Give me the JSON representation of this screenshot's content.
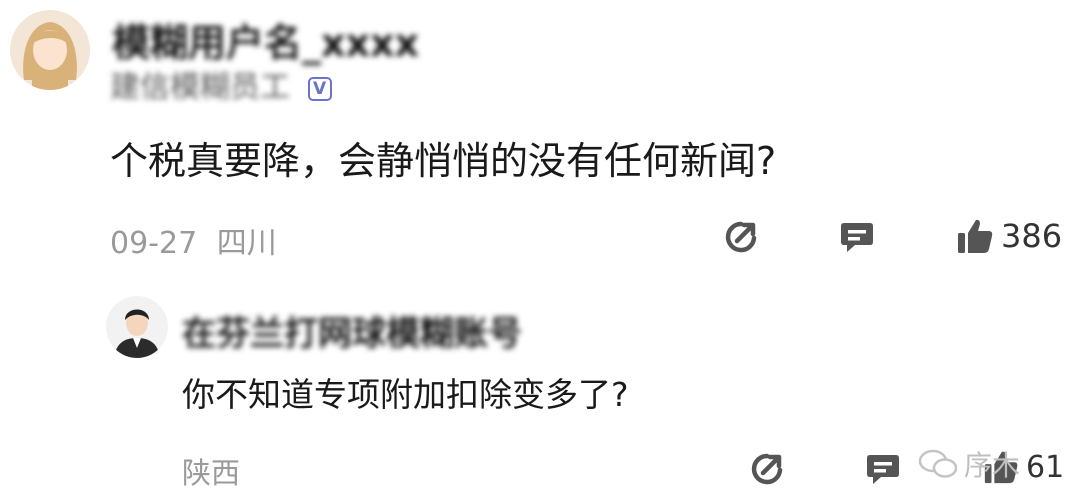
{
  "comment": {
    "username": "模糊用户名_xxxx",
    "user_subtitle": "建信模糊员工",
    "verified_mark": "V",
    "text": "个税真要降，会静悄悄的没有任何新闻?",
    "date": "09-27",
    "location": "四川",
    "like_count": "386"
  },
  "reply": {
    "username": "在芬兰打网球模糊账号",
    "text": "你不知道专项附加扣除变多了?",
    "location": "陕西",
    "like_count": "61"
  },
  "watermark": {
    "icon": "wechat-icon",
    "text": "序木"
  },
  "colors": {
    "icon_gray": "#555555",
    "meta_gray": "#9a9a9a",
    "verified": "#6a74c9"
  }
}
